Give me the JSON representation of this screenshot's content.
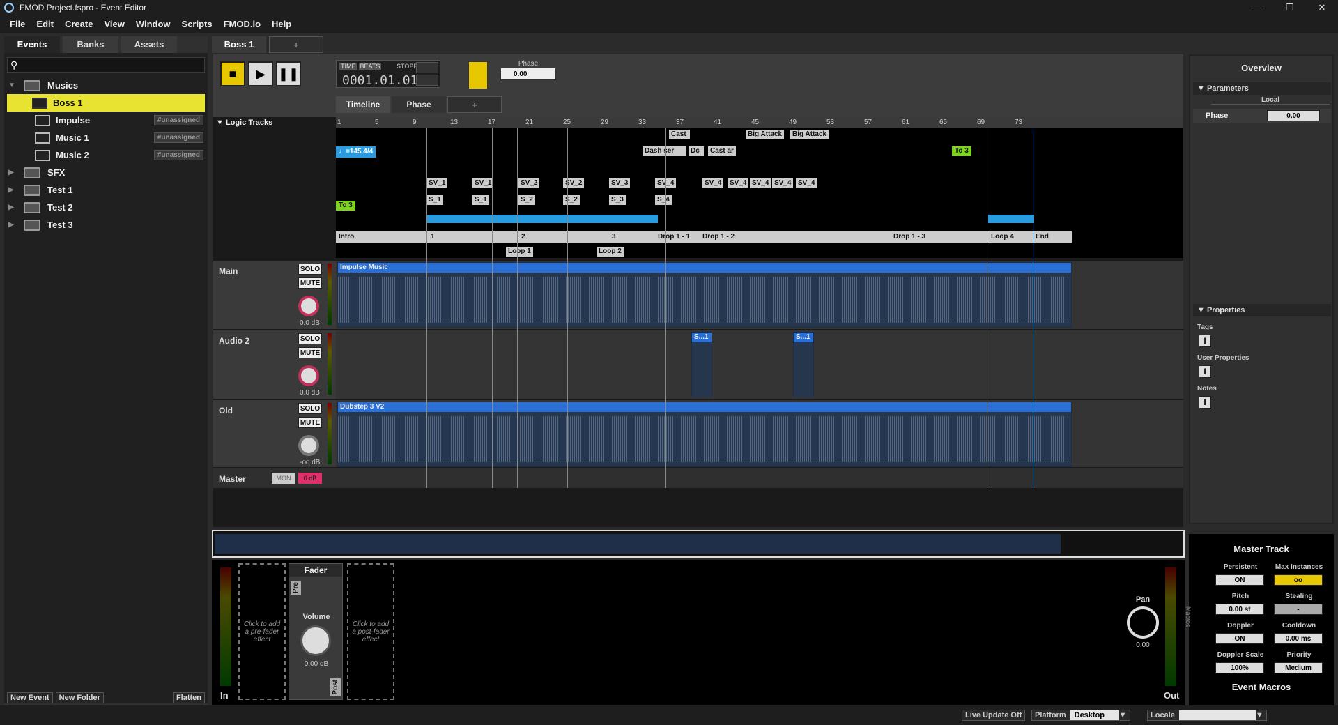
{
  "window": {
    "title": "FMOD Project.fspro - Event Editor",
    "min": "—",
    "max": "❐",
    "close": "✕"
  },
  "menu": [
    "File",
    "Edit",
    "Create",
    "View",
    "Window",
    "Scripts",
    "FMOD.io",
    "Help"
  ],
  "browser": {
    "tabs": [
      "Events",
      "Banks",
      "Assets"
    ],
    "search_icon": "search-icon",
    "tree": [
      {
        "label": "Musics",
        "type": "folder",
        "expanded": true
      },
      {
        "label": "Boss 1",
        "type": "event",
        "selected": true,
        "badge": ""
      },
      {
        "label": "Impulse",
        "type": "event",
        "badge": "#unassigned"
      },
      {
        "label": "Music 1",
        "type": "event",
        "badge": "#unassigned"
      },
      {
        "label": "Music 2",
        "type": "event",
        "badge": "#unassigned"
      },
      {
        "label": "SFX",
        "type": "folder"
      },
      {
        "label": "Test 1",
        "type": "folder"
      },
      {
        "label": "Test 2",
        "type": "folder"
      },
      {
        "label": "Test 3",
        "type": "folder"
      }
    ],
    "buttons": {
      "new_event": "New Event",
      "new_folder": "New Folder",
      "flatten": "Flatten"
    }
  },
  "event_tabs": {
    "active": "Boss 1",
    "add": "+"
  },
  "transport": {
    "time_tag": "TIME",
    "beats_tag": "BEATS",
    "state": "STOPPED",
    "position": "0001.01.01",
    "phase_label": "Phase",
    "phase_value": "0.00"
  },
  "sheet_tabs": [
    "Timeline",
    "Phase",
    "+"
  ],
  "logic_tracks_label": "Logic Tracks",
  "ruler": [
    "1",
    "5",
    "9",
    "13",
    "17",
    "21",
    "25",
    "29",
    "33",
    "37",
    "41",
    "45",
    "49",
    "53",
    "57",
    "61",
    "65",
    "69",
    "73"
  ],
  "logic": {
    "tempo": "=145 4/4",
    "to3_left": "To 3",
    "to3_right": "To 3",
    "markers_top": [
      "Big Attack",
      "Big Attack",
      "Cast",
      "Cast ar",
      "Dash",
      "Dash ser",
      "Dc"
    ],
    "sv_markers": [
      "SV_1",
      "SV_1",
      "SV_2",
      "SV_2",
      "SV_3",
      "SV_4",
      "SV_4",
      "SV_4",
      "SV_4",
      "SV_4",
      "SV_4"
    ],
    "s_markers": [
      "S_1",
      "S_1",
      "S_2",
      "S_2",
      "S_3",
      "S_4"
    ],
    "regions": [
      "Intro",
      "1",
      "2",
      "3",
      "Drop 1 - 1",
      "Drop 1 - 2",
      "Drop 1 - 3",
      "Loop 4",
      "End"
    ],
    "loops": [
      "Loop 1",
      "Loop 2"
    ]
  },
  "tracks": [
    {
      "name": "Main",
      "solo": "SOLO",
      "mute": "MUTE",
      "db": "0.0 dB",
      "clip": "Impulse Music"
    },
    {
      "name": "Audio 2",
      "solo": "SOLO",
      "mute": "MUTE",
      "db": "0.0 dB",
      "clip1": "S...1",
      "clip2": "S...1"
    },
    {
      "name": "Old",
      "solo": "SOLO",
      "mute": "MUTE",
      "db": "-oo dB",
      "clip": "Dubstep 3 V2"
    }
  ],
  "master": {
    "name": "Master",
    "mon": "MON",
    "rec": "0 dB"
  },
  "deck": {
    "in": "In",
    "out": "Out",
    "prefx": "Click to add a pre-fader effect",
    "postfx": "Click to add a post-fader effect",
    "fader_title": "Fader",
    "pre": "Pre",
    "post": "Post",
    "volume": "Volume",
    "volume_db": "0.00 dB",
    "pan": "Pan",
    "pan_value": "0.00"
  },
  "overview": {
    "title": "Overview",
    "parameters": "Parameters",
    "local": "Local",
    "param_name": "Phase",
    "param_value": "0.00",
    "properties": "Properties",
    "tags": "Tags",
    "user_props": "User Properties",
    "notes": "Notes"
  },
  "master_track": {
    "title": "Master Track",
    "persistent": "Persistent",
    "persistent_v": "ON",
    "max_inst": "Max Instances",
    "max_inst_v": "oo",
    "pitch": "Pitch",
    "pitch_v": "0.00 st",
    "stealing": "Stealing",
    "stealing_v": "-",
    "doppler": "Doppler",
    "doppler_v": "ON",
    "cooldown": "Cooldown",
    "cooldown_v": "0.00 ms",
    "doppler_scale": "Doppler Scale",
    "doppler_scale_v": "100%",
    "priority": "Priority",
    "priority_v": "Medium",
    "macros": "Macros",
    "event_macros": "Event Macros"
  },
  "status": {
    "live_update": "Live Update Off",
    "platform": "Platform",
    "platform_v": "Desktop",
    "locale": "Locale",
    "locale_v": ""
  }
}
